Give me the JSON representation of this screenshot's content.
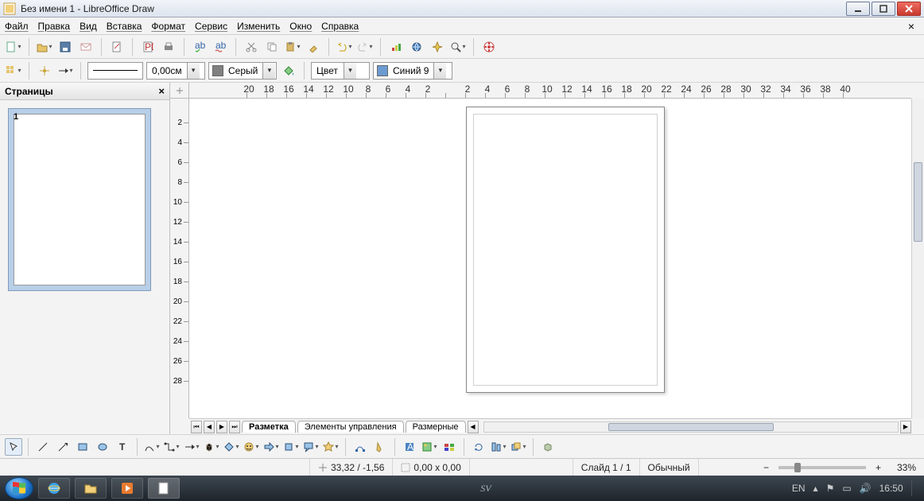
{
  "title": "Без имени 1 - LibreOffice Draw",
  "menu": [
    "Файл",
    "Правка",
    "Вид",
    "Вставка",
    "Формат",
    "Сервис",
    "Изменить",
    "Окно",
    "Справка"
  ],
  "toolbar2": {
    "line_width": "0,00см",
    "area_color_label": "Серый",
    "fill_type_label": "Цвет",
    "line_color_label": "Синий 9"
  },
  "pages_panel": {
    "title": "Страницы",
    "page_num": "1"
  },
  "ruler_h": [
    "20",
    "18",
    "16",
    "14",
    "12",
    "10",
    "8",
    "6",
    "4",
    "2",
    "",
    "2",
    "4",
    "6",
    "8",
    "10",
    "12",
    "14",
    "16",
    "18",
    "20",
    "22",
    "24",
    "26",
    "28",
    "30",
    "32",
    "34",
    "36",
    "38",
    "40"
  ],
  "ruler_v": [
    "2",
    "4",
    "6",
    "8",
    "10",
    "12",
    "14",
    "16",
    "18",
    "20",
    "22",
    "24",
    "26",
    "28"
  ],
  "tabs": {
    "t1": "Разметка",
    "t2": "Элементы управления",
    "t3": "Размерные"
  },
  "status": {
    "pos": "33,32 / -1,56",
    "size": "0,00 x 0,00",
    "slide": "Слайд 1 / 1",
    "style": "Обычный",
    "zoom": "33%"
  },
  "watermark": "SV",
  "tray": {
    "lang": "EN",
    "time": "16:50"
  }
}
